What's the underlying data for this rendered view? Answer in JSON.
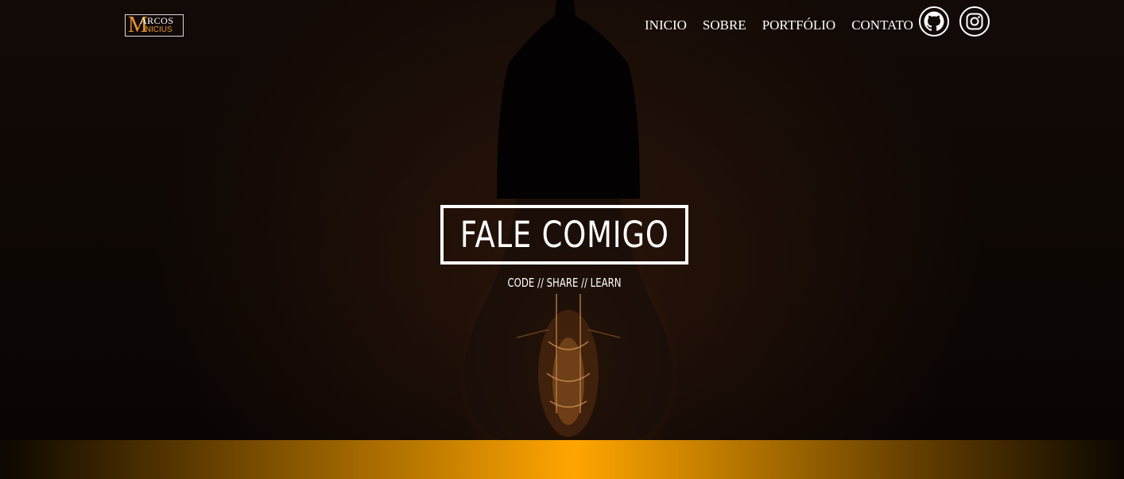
{
  "logo": {
    "letter": "M",
    "top": "ARCOS",
    "bottom": "INICIUS"
  },
  "nav": {
    "items": [
      {
        "label": "INICIO"
      },
      {
        "label": "SOBRE"
      },
      {
        "label": "PORTFÓLIO"
      },
      {
        "label": "CONTATO"
      }
    ]
  },
  "social": {
    "github_icon": "github-icon",
    "instagram_icon": "instagram-icon"
  },
  "hero": {
    "title": "FALE COMIGO",
    "tagline": "CODE // SHARE // LEARN"
  },
  "colors": {
    "accent": "#ffa500",
    "logo_accent": "#e8962a",
    "text": "#ffffff"
  }
}
